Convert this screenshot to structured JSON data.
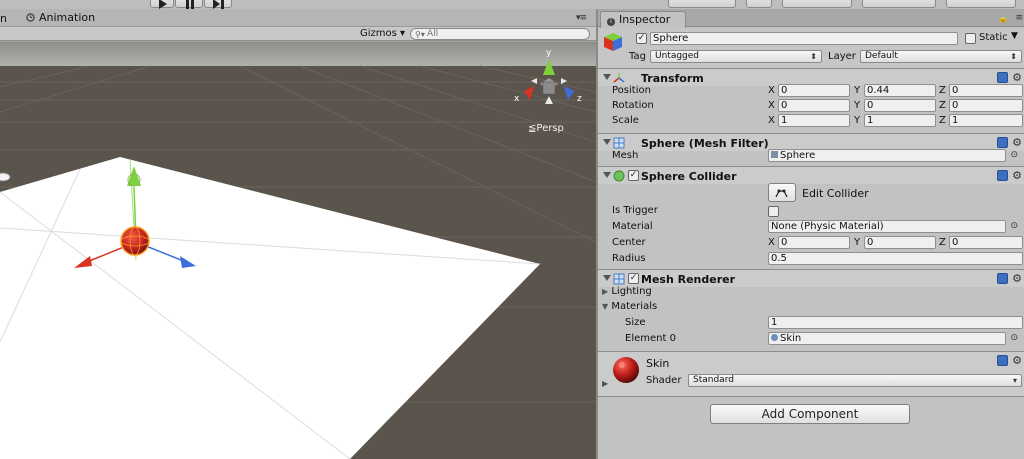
{
  "toolbar": {
    "play_icon": "play-icon",
    "pause_icon": "pause-icon",
    "step_icon": "step-icon"
  },
  "scene": {
    "tab_partial": "n",
    "tab_animation": "Animation",
    "gizmos_label": "Gizmos",
    "search_placeholder": "All",
    "persp_label": "Persp",
    "axis_x": "x",
    "axis_y": "y",
    "axis_z": "z"
  },
  "inspector": {
    "tab_label": "Inspector",
    "object": {
      "name": "Sphere",
      "active": true,
      "static_label": "Static",
      "static_checked": false,
      "tag_label": "Tag",
      "tag_value": "Untagged",
      "layer_label": "Layer",
      "layer_value": "Default"
    },
    "transform": {
      "title": "Transform",
      "position_label": "Position",
      "rotation_label": "Rotation",
      "scale_label": "Scale",
      "x_label": "X",
      "y_label": "Y",
      "z_label": "Z",
      "position": {
        "x": "0",
        "y": "0.44",
        "z": "0"
      },
      "rotation": {
        "x": "0",
        "y": "0",
        "z": "0"
      },
      "scale": {
        "x": "1",
        "y": "1",
        "z": "1"
      }
    },
    "mesh_filter": {
      "title": "Sphere (Mesh Filter)",
      "mesh_label": "Mesh",
      "mesh_value": "Sphere"
    },
    "sphere_collider": {
      "title": "Sphere Collider",
      "enabled": true,
      "edit_label": "Edit Collider",
      "is_trigger_label": "Is Trigger",
      "is_trigger": false,
      "material_label": "Material",
      "material_value": "None (Physic Material)",
      "center_label": "Center",
      "center": {
        "x": "0",
        "y": "0",
        "z": "0"
      },
      "radius_label": "Radius",
      "radius_value": "0.5"
    },
    "mesh_renderer": {
      "title": "Mesh Renderer",
      "enabled": true,
      "lighting_label": "Lighting",
      "materials_label": "Materials",
      "size_label": "Size",
      "size_value": "1",
      "element0_label": "Element 0",
      "element0_value": "Skin"
    },
    "material": {
      "name": "Skin",
      "shader_label": "Shader",
      "shader_value": "Standard"
    },
    "add_component_label": "Add Component"
  },
  "colors": {
    "sky": "#8f8e8a",
    "ground": "#5b544d",
    "plane": "#ffffff",
    "axis_x": "#d9341f",
    "axis_y": "#7ed13a",
    "axis_z": "#3d6fd8",
    "sphere": "#c4231f"
  }
}
